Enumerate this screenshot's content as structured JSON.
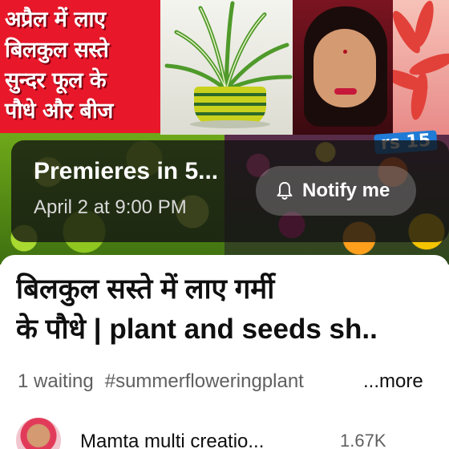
{
  "thumbnail": {
    "headline_lines": [
      "अप्रैल में लाए",
      "बिलकुल सस्ते",
      "सुन्दर फूल के",
      "पौधे और बीज"
    ],
    "price_tag": "rs 15",
    "headline_bg": "#e8182a"
  },
  "premiere": {
    "title": "Premieres in 5...",
    "time": "April 2 at 9:00 PM",
    "notify_label": "Notify me",
    "notify_icon": "bell-icon"
  },
  "video": {
    "title_lines": [
      "बिलकुल सस्ते में लाए गर्मी",
      "के पौधे |  plant and seeds sh.."
    ],
    "waiting": "1 waiting",
    "hashtag": "#summerfloweringplant",
    "more_label": "...more"
  },
  "channel": {
    "name": "Mamta multi creatio...",
    "subscribers": "1.67K"
  }
}
